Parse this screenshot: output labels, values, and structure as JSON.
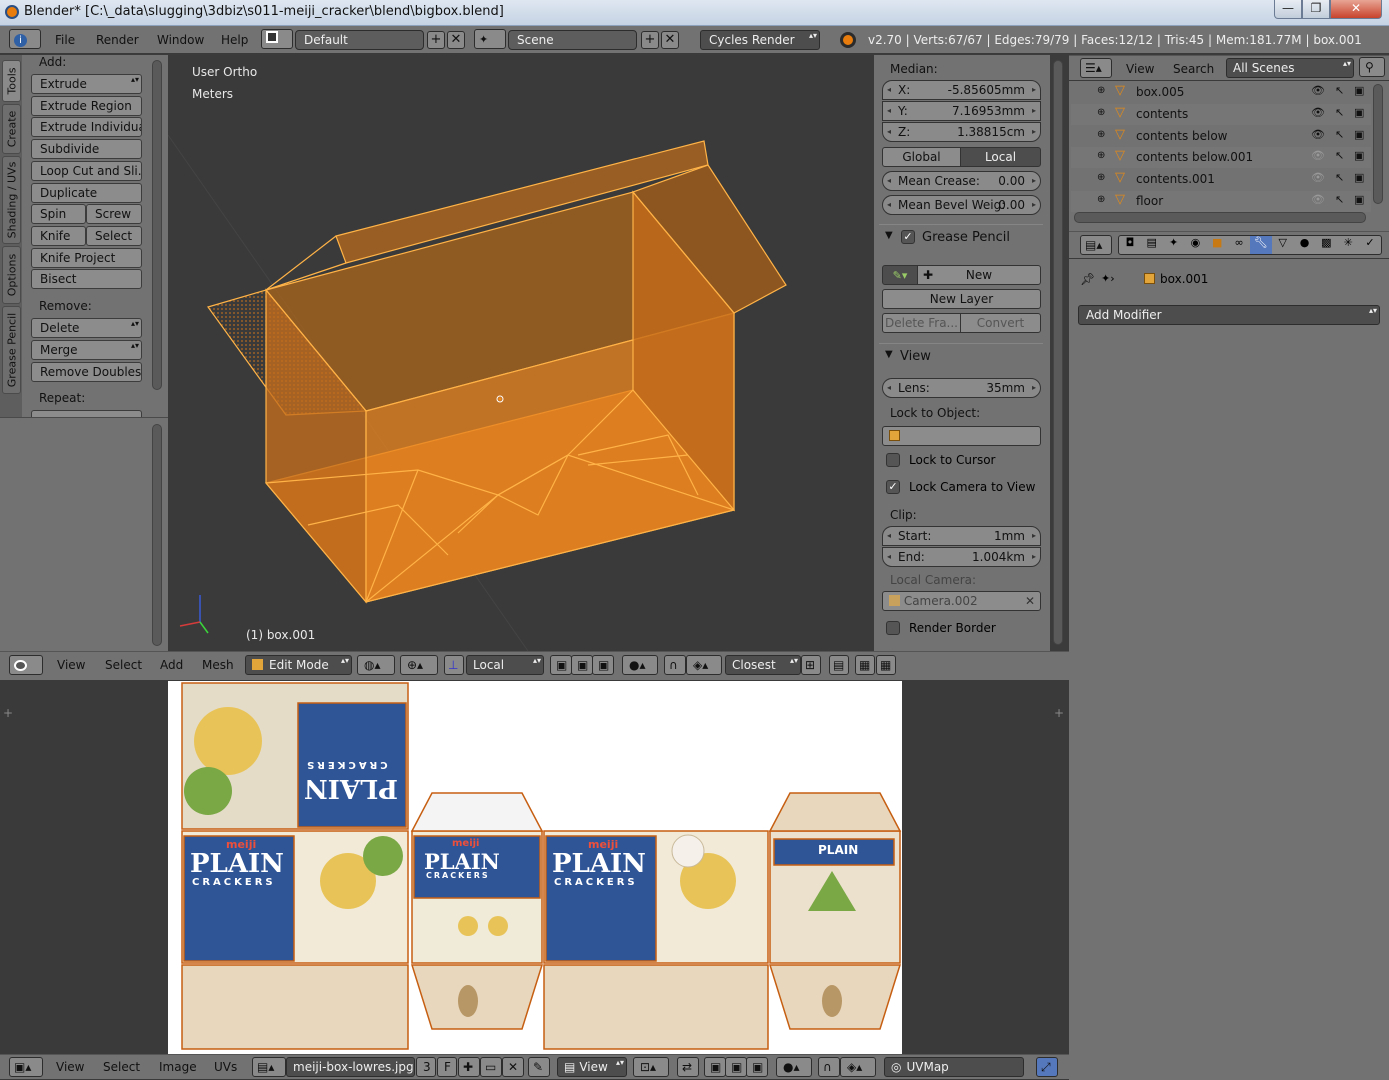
{
  "window": {
    "title": "Blender* [C:\\_data\\slugging\\3dbiz\\s011-meiji_cracker\\blend\\bigbox.blend]",
    "min_glyph": "—",
    "max_glyph": "❐",
    "close_glyph": "✕"
  },
  "menubar": {
    "menus": [
      "File",
      "Render",
      "Window",
      "Help"
    ],
    "layout": "Default",
    "scene": "Scene",
    "engine": "Cycles Render",
    "stats": "v2.70 | Verts:67/67 | Edges:79/79 | Faces:12/12 | Tris:45 | Mem:181.77M | box.001"
  },
  "toolshelf": {
    "tabs": [
      "Tools",
      "Create",
      "Shading / UVs",
      "Options",
      "Grease Pencil"
    ],
    "add_label": "Add:",
    "extrude": "Extrude",
    "extrude_region": "Extrude Region",
    "extrude_individual": "Extrude Individual",
    "subdivide": "Subdivide",
    "loop_cut": "Loop Cut and Sli...",
    "duplicate": "Duplicate",
    "spin": "Spin",
    "screw": "Screw",
    "knife": "Knife",
    "select": "Select",
    "knife_project": "Knife Project",
    "bisect": "Bisect",
    "remove_label": "Remove:",
    "delete": "Delete",
    "merge": "Merge",
    "remove_doubles": "Remove Doubles",
    "repeat_label": "Repeat:"
  },
  "viewport": {
    "view_name": "User Ortho",
    "units": "Meters",
    "object_label": "(1) box.001",
    "mesh_color": "#f08a1c"
  },
  "npanel": {
    "median_label": "Median:",
    "x_label": "X:",
    "x_value": "-5.85605mm",
    "y_label": "Y:",
    "y_value": "7.16953mm",
    "z_label": "Z:",
    "z_value": "1.38815cm",
    "global": "Global",
    "local": "Local",
    "mean_crease_label": "Mean Crease:",
    "mean_crease_value": "0.00",
    "mean_bevel_label": "Mean Bevel Weig:",
    "mean_bevel_value": "0.00",
    "grease_pencil": "Grease Pencil",
    "new": "New",
    "new_layer": "New Layer",
    "delete_frame": "Delete Fra...",
    "convert": "Convert",
    "view_panel": "View",
    "lens_label": "Lens:",
    "lens_value": "35mm",
    "lock_to_object": "Lock to Object:",
    "lock_to_cursor": "Lock to Cursor",
    "lock_camera": "Lock Camera to View",
    "clip_label": "Clip:",
    "start_label": "Start:",
    "start_value": "1mm",
    "end_label": "End:",
    "end_value": "1.004km",
    "local_camera": "Local Camera:",
    "camera_name": "Camera.002",
    "render_border": "Render Border"
  },
  "outliner": {
    "view": "View",
    "search": "Search",
    "scenes": "All Scenes",
    "items": [
      "box.005",
      "contents",
      "contents below",
      "contents below.001",
      "contents.001",
      "floor"
    ]
  },
  "properties": {
    "object_name": "box.001",
    "add_modifier": "Add Modifier"
  },
  "viewport_header": {
    "view": "View",
    "select": "Select",
    "add": "Add",
    "mesh": "Mesh",
    "mode": "Edit Mode",
    "orientation": "Local",
    "snap": "Closest"
  },
  "uv_header": {
    "view": "View",
    "select": "Select",
    "image": "Image",
    "uvs": "UVs",
    "image_name": "meiji-box-lowres.jpg",
    "users": "3",
    "fake": "F",
    "view_mode": "View",
    "uvmap": "UVMap"
  },
  "uv_texture": {
    "brand": "meiji",
    "product": "PLAIN",
    "sub": "CRACKERS",
    "panel_color": "#2f5597",
    "cardboard": "#e9d7bd"
  }
}
